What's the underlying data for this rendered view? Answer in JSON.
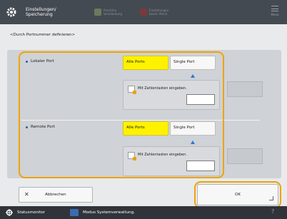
{
  "header": {
    "title": "Einstellungen/\nSpeicherung",
    "btn1": "Prioritäre\nVerarbeitung",
    "btn2": "Einstellungen\nbearb. Menü",
    "menu_label": "Menü"
  },
  "page": {
    "title": "<Durch Portnummer definieren>"
  },
  "sections": {
    "local": {
      "label": "Lokaler Port",
      "opt_all": "Alle Ports",
      "opt_single": "Single Port",
      "hint": "Mit Zahlentasten eingeben.",
      "value": ""
    },
    "remote": {
      "label": "Remote Port",
      "opt_all": "Alle Ports",
      "opt_single": "Single Port",
      "hint": "Mit Zahlentasten eingeben.",
      "value": ""
    }
  },
  "buttons": {
    "cancel": "Abbrechen",
    "ok": "OK"
  },
  "footer": {
    "status": "Statusmonitor",
    "mode": "Modus Systemverwaltung."
  },
  "colors": {
    "selected": "#fff200",
    "highlight": "#efa300",
    "header_bg": "#444a52",
    "footer_bg": "#30343a"
  },
  "icons": [
    "gear-icon",
    "priority-icon",
    "edit-menu-icon",
    "menu-icon",
    "keyboard-icon",
    "close-icon",
    "status-monitor-icon",
    "system-admin-icon",
    "help-icon"
  ]
}
